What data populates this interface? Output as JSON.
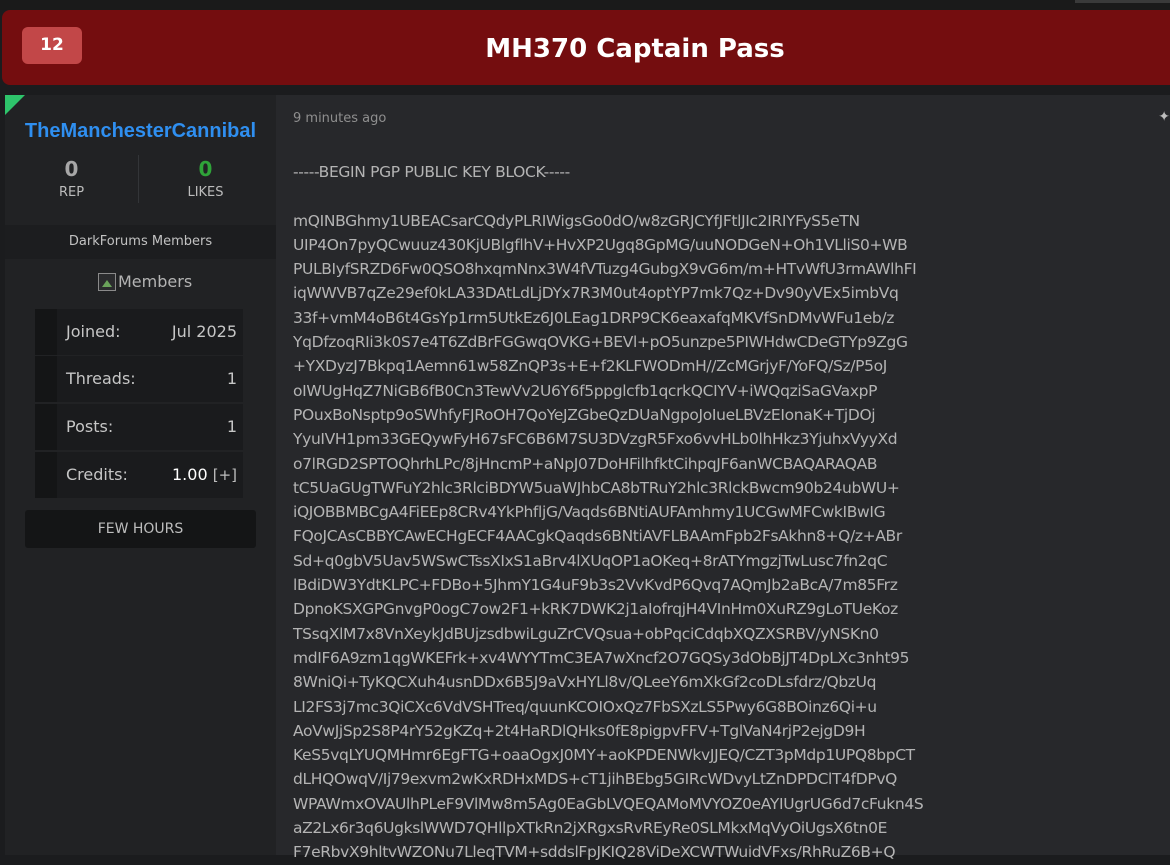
{
  "header": {
    "reply_count": "12",
    "title": "MH370 Captain Pass"
  },
  "author": {
    "username": "TheManchesterCannibal",
    "rep_value": "0",
    "rep_label": "REP",
    "likes_value": "0",
    "likes_label": "LIKES",
    "group": "DarkForums Members",
    "group_image_alt": "Members",
    "info": [
      {
        "label": "Joined:",
        "value": "Jul 2025"
      },
      {
        "label": "Threads:",
        "value": "1"
      },
      {
        "label": "Posts:",
        "value": "1"
      },
      {
        "label": "Credits:",
        "value": "1.00",
        "action": "[+]"
      }
    ],
    "activity": "FEW HOURS",
    "online_color": "#2ec46b",
    "username_color": "#2f8ff0"
  },
  "post": {
    "timestamp": "9 minutes ago",
    "lines": [
      "-----BEGIN PGP PUBLIC KEY BLOCK-----",
      "",
      "mQINBGhmy1UBEACsarCQdyPLRIWigsGo0dO/w8zGRJCYfJFtlJIc2IRIYFyS5eTN",
      "UIP4On7pyQCwuuz430KjUBlgflhV+HvXP2Ugq8GpMG/uuNODGeN+Oh1VLliS0+WB",
      "PULBIyfSRZD6Fw0QSO8hxqmNnx3W4fVTuzg4GubgX9vG6m/m+HTvWfU3rmAWlhFI",
      "iqWWVB7qZe29ef0kLA33DAtLdLjDYx7R3M0ut4optYP7mk7Qz+Dv90yVEx5imbVq",
      "33f+vmM4oB6t4GsYp1rm5UtkEz6J0LEag1DRP9CK6eaxafqMKVfSnDMvWFu1eb/z",
      "YqDfzoqRIi3k0S7e4T6ZdBrFGGwqOVKG+BEVl+pO5unzpe5PIWHdwCDeGTYp9ZgG",
      "+YXDyzJ7Bkpq1Aemn61w58ZnQP3s+E+f2KLFWODmH//ZcMGrjyF/YoFQ/Sz/P5oJ",
      "oIWUgHqZ7NiGB6fB0Cn3TewVv2U6Y6f5ppglcfb1qcrkQCIYV+iWQqziSaGVaxpP",
      "POuxBoNsptp9oSWhfyFJRoOH7QoYeJZGbeQzDUaNgpoJoIueLBVzEIonaK+TjDOj",
      "YyuIVH1pm33GEQywFyH67sFC6B6M7SU3DVzgR5Fxo6vvHLb0lhHkz3YjuhxVyyXd",
      "o7lRGD2SPTOQhrhLPc/8jHncmP+aNpJ07DoHFilhfktCihpqJF6anWCBAQARAQAB",
      "tC5UaGUgTWFuY2hlc3RlciBDYW5uaWJhbCA8bTRuY2hlc3RlckBwcm90b24ubWU+",
      "iQJOBBMBCgA4FiEEp8CRv4YkPhfljG/Vaqds6BNtiAUFAmhmy1UCGwMFCwkIBwIG",
      "FQoJCAsCBBYCAwECHgECF4AACgkQaqds6BNtiAVFLBAAmFpb2FsAkhn8+Q/z+ABr",
      "Sd+q0gbV5Uav5WSwCTssXIxS1aBrv4lXUqOP1aOKeq+8rATYmgzjTwLusc7fn2qC",
      "lBdiDW3YdtKLPC+FDBo+5JhmY1G4uF9b3s2VvKvdP6Qvq7AQmJb2aBcA/7m85Frz",
      "DpnoKSXGPGnvgP0ogC7ow2F1+kRK7DWK2j1aIofrqjH4VInHm0XuRZ9gLoTUeKoz",
      "TSsqXlM7x8VnXeykJdBUjzsdbwiLguZrCVQsua+obPqciCdqbXQZXSRBV/yNSKn0",
      "mdIF6A9zm1qgWKEFrk+xv4WYYTmC3EA7wXncf2O7GQSy3dObBjJT4DpLXc3nht95",
      "8WniQi+TyKQCXuh4usnDDx6B5J9aVxHYLl8v/QLeeY6mXkGf2coDLsfdrz/QbzUq",
      "LI2FS3j7mc3QiCXc6VdVSHTreq/quunKCOIOxQz7FbSXzLS5Pwy6G8BOinz6Qi+u",
      "AoVwJjSp2S8P4rY52gKZq+2t4HaRDlQHks0fE8pigpvFFV+TglVaN4rjP2ejgD9H",
      "KeS5vqLYUQMHmr6EgFTG+oaaOgxJ0MY+aoKPDENWkvJJEQ/CZT3pMdp1UPQ8bpCT",
      "dLHQOwqV/Ij79exvm2wKxRDHxMDS+cT1jihBEbg5GIRcWDvyLtZnDPDClT4fDPvQ",
      "WPAWmxOVAUlhPLeF9VlMw8m5Ag0EaGbLVQEQAMoMVYOZ0eAYIUgrUG6d7cFukn4S",
      "aZ2Lx6r3q6UgkslWWD7QHllpXTkRn2jXRgxsRvREyRe0SLMkxMqVyOiUgsX6tn0E",
      "F7eRbvX9hltvWZONu7LleqTVM+sddslFpJKIQ28ViDeXCWTWuidVFxs/RhRuZ6B+Q"
    ]
  }
}
